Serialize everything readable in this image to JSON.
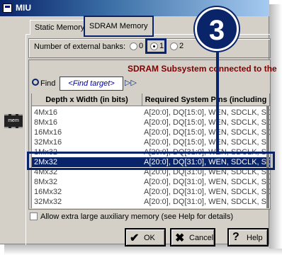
{
  "window": {
    "title": "MIU"
  },
  "tabs": [
    {
      "label": "Static Memory"
    },
    {
      "label": "SDRAM Memory"
    }
  ],
  "badge": {
    "number": "3"
  },
  "banks": {
    "label": "Number of external banks:",
    "options": [
      "0",
      "1",
      "2"
    ],
    "selected": "1"
  },
  "subsystem": {
    "title": "SDRAM Subsystem connected to the"
  },
  "find": {
    "label": "Find",
    "placeholder": "<Find target>",
    "next": "▷▷"
  },
  "table": {
    "columns": [
      "Depth x Width (in bits)",
      "Required System Pins (including"
    ],
    "rows": [
      {
        "c1": "4Mx16",
        "c2": "A[20:0], DQ[15:0], WEN, SDCLK, SD"
      },
      {
        "c1": "8Mx16",
        "c2": "A[20:0], DQ[15:0], WEN, SDCLK, SD"
      },
      {
        "c1": "16Mx16",
        "c2": "A[20:0], DQ[15:0], WEN, SDCLK, SD"
      },
      {
        "c1": "32Mx16",
        "c2": "A[20:0], DQ[15:0], WEN, SDCLK, S"
      },
      {
        "c1": "1Mx32",
        "c2": "A[20:0], DQ[31:0], WEN, SDCLK, S"
      },
      {
        "c1": "2Mx32",
        "c2": "A[20:0], DQ[31:0], WEN, SDCLK, SD"
      },
      {
        "c1": "4Mx32",
        "c2": "A[20:0], DQ[31:0], WEN, SDCLK, SD"
      },
      {
        "c1": "8Mx32",
        "c2": "A[20:0], DQ[31:0], WEN, SDCLK, SD"
      },
      {
        "c1": "16Mx32",
        "c2": "A[20:0], DQ[31:0], WEN, SDCLK, SD"
      },
      {
        "c1": "32Mx32",
        "c2": "A[20:0], DQ[31:0], WEN, SDCLK, S"
      }
    ],
    "selected_index": 5
  },
  "checkbox": {
    "label": "Allow extra large auxiliary memory (see Help for details)"
  },
  "buttons": {
    "ok": "OK",
    "cancel": "Cancel",
    "help": "Help"
  },
  "mem_icon": {
    "label": "mem"
  },
  "colors": {
    "highlight": "#0a246a",
    "title_red": "#800000"
  }
}
